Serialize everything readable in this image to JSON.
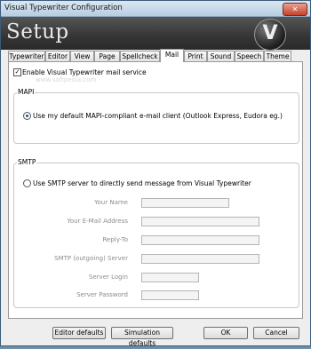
{
  "window": {
    "title": "Visual Typewriter Configuration",
    "close_glyph": "✕"
  },
  "banner": {
    "title": "Setup",
    "logo_letter": "V"
  },
  "tabs": [
    {
      "label": "Typewriter"
    },
    {
      "label": "Editor"
    },
    {
      "label": "View"
    },
    {
      "label": "Page"
    },
    {
      "label": "Spellcheck"
    },
    {
      "label": "Mail",
      "active": true
    },
    {
      "label": "Print"
    },
    {
      "label": "Sound"
    },
    {
      "label": "Speech"
    },
    {
      "label": "Theme"
    }
  ],
  "mail": {
    "enable_label": "Enable Visual Typewriter mail service",
    "enable_checked": true,
    "watermark": "www.softpedia.com",
    "mapi_title": "MAPI",
    "mapi_option": "Use my default MAPI-compliant e-mail client (Outlook Express, Eudora eg.)",
    "smtp_title": "SMTP",
    "smtp_option": "Use SMTP server to directly send message from Visual Typewriter",
    "fields": {
      "name": {
        "label": "Your Name",
        "value": ""
      },
      "email": {
        "label": "Your E-Mail Address",
        "value": ""
      },
      "reply": {
        "label": "Reply-To",
        "value": ""
      },
      "server": {
        "label": "SMTP (outgoing) Server",
        "value": ""
      },
      "login": {
        "label": "Server Login",
        "value": ""
      },
      "password": {
        "label": "Server Password",
        "value": ""
      }
    }
  },
  "buttons": {
    "editor_defaults": "Editor defaults",
    "simulation_defaults": "Simulation defaults",
    "ok": "OK",
    "cancel": "Cancel"
  },
  "colors": {
    "accent": "#1f4f8f",
    "banner": "#353535"
  }
}
